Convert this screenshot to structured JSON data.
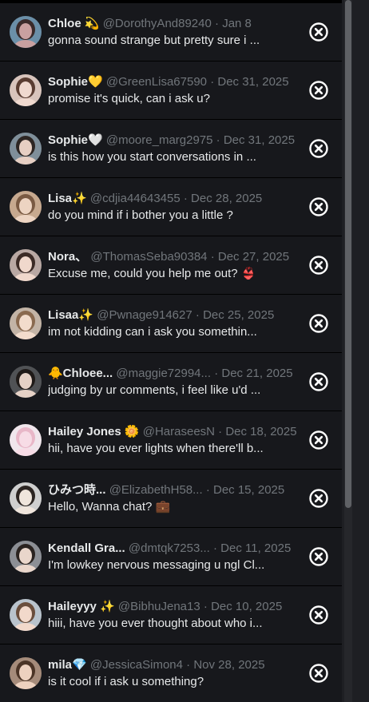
{
  "conversations": [
    {
      "name": "Chloe 💫",
      "handle": "@DorothyAnd89240",
      "date": "Jan 8",
      "preview": "gonna sound strange but pretty sure i ..."
    },
    {
      "name": "Sophie💛",
      "handle": "@GreenLisa67590",
      "date": "Dec 31, 2025",
      "preview": "promise it's quick, can i ask u?"
    },
    {
      "name": "Sophie🤍",
      "handle": "@moore_marg2975",
      "date": "Dec 31, 2025",
      "preview": "is this how you start conversations in ..."
    },
    {
      "name": "Lisa✨",
      "handle": "@cdjia44643455",
      "date": "Dec 28, 2025",
      "preview": "do you mind if i bother you a little ?"
    },
    {
      "name": "Nora、",
      "handle": "@ThomasSeba90384",
      "date": "Dec 27, 2025",
      "preview": "Excuse me, could you help me out? 👙"
    },
    {
      "name": "Lisaa✨",
      "handle": "@Pwnage914627",
      "date": "Dec 25, 2025",
      "preview": "im not kidding can i ask you somethin..."
    },
    {
      "name": "🐥Chloee...",
      "handle": "@maggie72994...",
      "date": "Dec 21, 2025",
      "preview": "judging by ur comments, i feel like u'd ..."
    },
    {
      "name": "Hailey Jones 🌼",
      "handle": "@HaraseesN",
      "date": "Dec 18, 2025",
      "preview": "hii, have you ever lights when there'll b..."
    },
    {
      "name": "ひみつ時...",
      "handle": "@ElizabethH58...",
      "date": "Dec 15, 2025",
      "preview": "Hello, Wanna chat? 💼"
    },
    {
      "name": "Kendall Gra...",
      "handle": "@dmtqk7253...",
      "date": "Dec 11, 2025",
      "preview": "I'm lowkey nervous messaging u ngl Cl..."
    },
    {
      "name": "Haileyyy ✨",
      "handle": "@BibhuJena13",
      "date": "Dec 10, 2025",
      "preview": "hiii, have you ever thought about who i..."
    },
    {
      "name": "mila💎",
      "handle": "@JessicaSimon4",
      "date": "Nov 28, 2025",
      "preview": "is it cool if i ask u something?"
    }
  ],
  "separator": "·",
  "icons": {
    "close": "close-circle-icon",
    "avatar": "avatar-photo"
  },
  "colors": {
    "background": "#17181c",
    "name": "#e7e9ea",
    "secondary": "#71767b",
    "divider": "#000000",
    "icon": "#ffffff"
  },
  "avatar_tones": [
    [
      "#6b8fa8",
      "#c9a0a0",
      "#3a2a2a"
    ],
    [
      "#d8c4bc",
      "#f0d9cf",
      "#5a3d32"
    ],
    [
      "#7f8f9a",
      "#e6cfc3",
      "#2d2623"
    ],
    [
      "#c7a98f",
      "#edd4c2",
      "#7a5a43"
    ],
    [
      "#b9a8a3",
      "#f0d8cc",
      "#3c2b26"
    ],
    [
      "#c3b4a6",
      "#f2dccc",
      "#8a6a4f"
    ],
    [
      "#505255",
      "#e5d1c6",
      "#1f1a18"
    ],
    [
      "#f0e6ec",
      "#f7dce6",
      "#e8b7c8"
    ],
    [
      "#cfcfcf",
      "#efe5dc",
      "#2c2522"
    ],
    [
      "#8c8f95",
      "#e9d6cb",
      "#2a2320"
    ],
    [
      "#b9c3cc",
      "#f2d9cb",
      "#6a4e3c"
    ],
    [
      "#a58b7a",
      "#edd1bf",
      "#4b3426"
    ]
  ]
}
